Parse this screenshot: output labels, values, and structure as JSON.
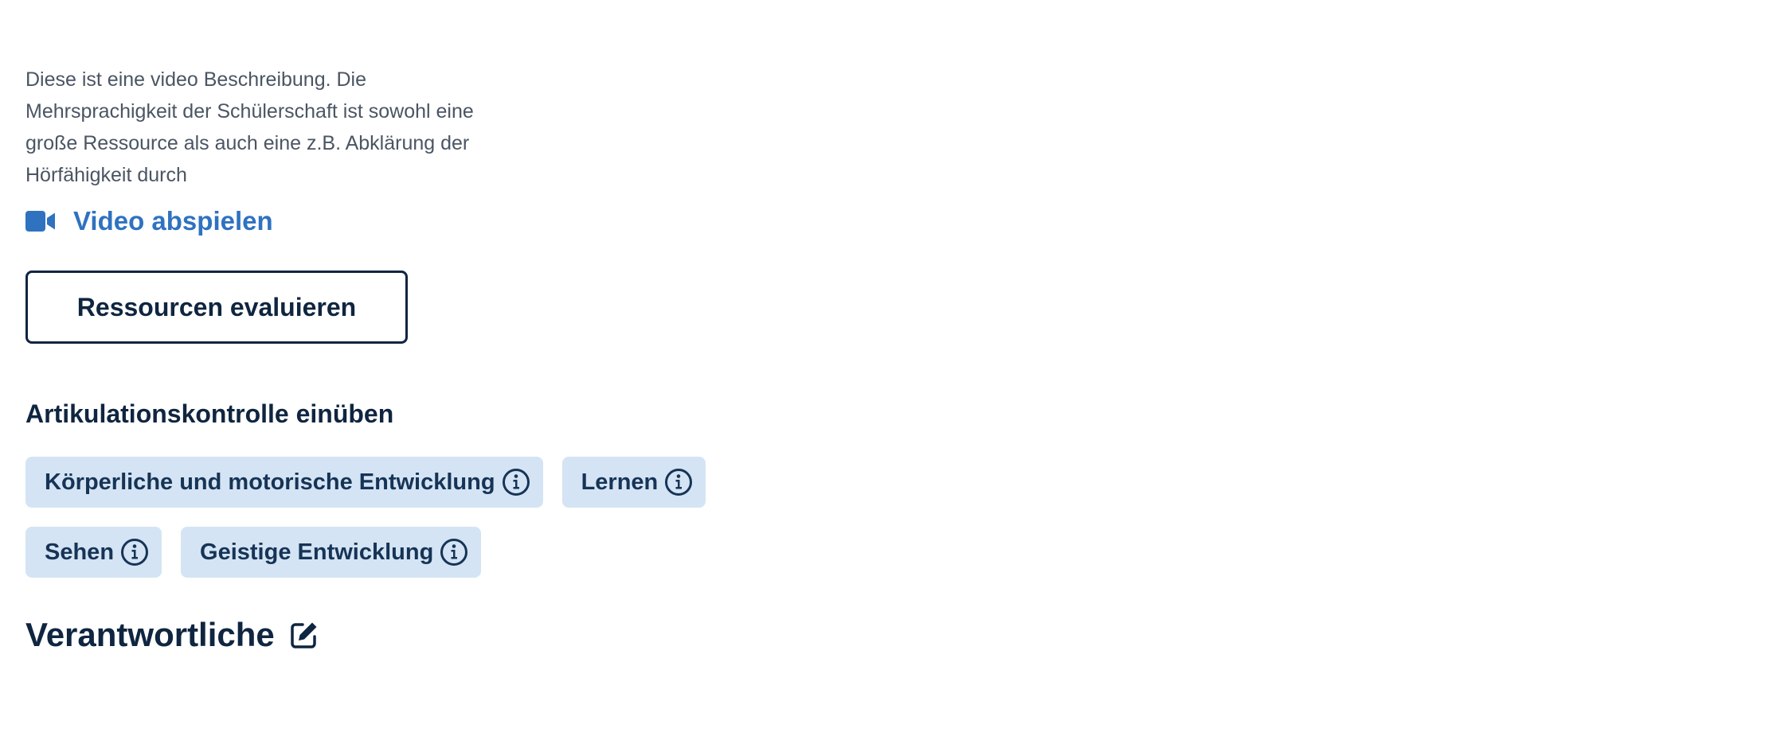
{
  "description": "Diese ist eine video Beschreibung. Die Mehrsprachigkeit der Schülerschaft ist sowohl eine große Ressource als auch eine z.B. Abklärung der Hörfähigkeit durch",
  "video_link": {
    "label": "Video abspielen",
    "icon": "video-camera-icon"
  },
  "evaluate_button": {
    "label": "Ressourcen evaluieren"
  },
  "section_heading": "Artikulationskontrolle einüben",
  "tags": [
    {
      "label": "Körperliche und motorische Entwicklung",
      "icon": "info-circle-icon"
    },
    {
      "label": "Lernen",
      "icon": "info-circle-icon"
    },
    {
      "label": "Sehen",
      "icon": "info-circle-icon"
    },
    {
      "label": "Geistige Entwicklung",
      "icon": "info-circle-icon"
    }
  ],
  "responsible": {
    "heading": "Verantwortliche",
    "icon": "edit-icon"
  },
  "colors": {
    "text_primary": "#0f2540",
    "text_secondary": "#4b5563",
    "link": "#2f72c0",
    "tag_background": "#d4e4f4"
  }
}
